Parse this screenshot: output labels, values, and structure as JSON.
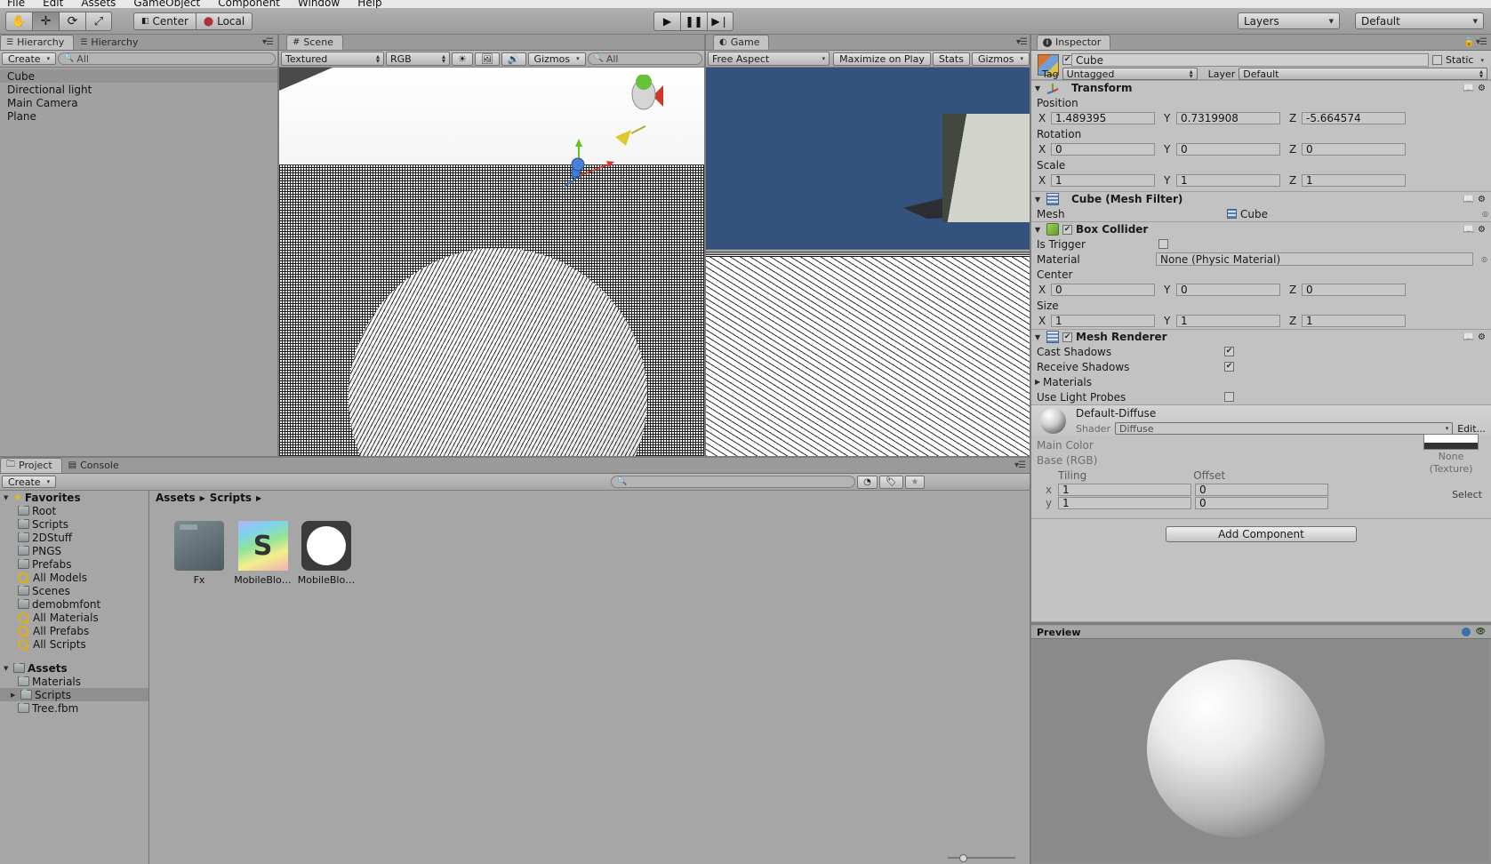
{
  "app": {
    "menu": [
      "File",
      "Edit",
      "Assets",
      "GameObject",
      "Component",
      "Window",
      "Help"
    ]
  },
  "toolbar": {
    "tools": [
      {
        "name": "hand-tool",
        "glyph": "✋",
        "active": false
      },
      {
        "name": "move-tool",
        "glyph": "✛",
        "active": true
      },
      {
        "name": "rotate-tool",
        "glyph": "⟳",
        "active": false
      },
      {
        "name": "scale-tool",
        "glyph": "⤢",
        "active": false
      }
    ],
    "pivot_label": "Center",
    "space_label": "Local",
    "play_label": "▶",
    "pause_label": "❚❚",
    "step_label": "▶❘",
    "layers_label": "Layers",
    "layout_label": "Default"
  },
  "hierarchy": {
    "tab_label": "Hierarchy",
    "tab_label_2": "Hierarchy",
    "create_label": "Create",
    "search_placeholder": "All",
    "items": [
      {
        "label": "Cube",
        "selected": true
      },
      {
        "label": "Directional light",
        "selected": false
      },
      {
        "label": "Main Camera",
        "selected": false
      },
      {
        "label": "Plane",
        "selected": false
      }
    ]
  },
  "scene": {
    "tab_label": "Scene",
    "draw_mode": "Textured",
    "render_mode": "RGB",
    "gizmos_label": "Gizmos",
    "search_placeholder": "All",
    "lighting_icon": "sun-icon",
    "fx_icon": "image-icon",
    "audio_icon": "speaker-icon"
  },
  "game": {
    "tab_label": "Game",
    "aspect_label": "Free Aspect",
    "maximize_label": "Maximize on Play",
    "stats_label": "Stats",
    "gizmos_label": "Gizmos"
  },
  "inspector": {
    "tab_label": "Inspector",
    "object_name": "Cube",
    "object_enabled": true,
    "static_label": "Static",
    "tag_label": "Tag",
    "tag_value": "Untagged",
    "layer_label": "Layer",
    "layer_value": "Default",
    "transform": {
      "title": "Transform",
      "position_label": "Position",
      "position": {
        "x": "1.489395",
        "y": "0.7319908",
        "z": "-5.664574"
      },
      "rotation_label": "Rotation",
      "rotation": {
        "x": "0",
        "y": "0",
        "z": "0"
      },
      "scale_label": "Scale",
      "scale": {
        "x": "1",
        "y": "1",
        "z": "1"
      }
    },
    "mesh_filter": {
      "title": "Cube (Mesh Filter)",
      "mesh_label": "Mesh",
      "mesh_value": "Cube"
    },
    "box_collider": {
      "title": "Box Collider",
      "enabled": true,
      "is_trigger_label": "Is Trigger",
      "is_trigger": false,
      "material_label": "Material",
      "material_value": "None (Physic Material)",
      "center_label": "Center",
      "center": {
        "x": "0",
        "y": "0",
        "z": "0"
      },
      "size_label": "Size",
      "size": {
        "x": "1",
        "y": "1",
        "z": "1"
      }
    },
    "mesh_renderer": {
      "title": "Mesh Renderer",
      "enabled": true,
      "cast_shadows_label": "Cast Shadows",
      "cast_shadows": true,
      "receive_shadows_label": "Receive Shadows",
      "receive_shadows": true,
      "materials_label": "Materials",
      "use_light_probes_label": "Use Light Probes",
      "use_light_probes": false
    },
    "material": {
      "name": "Default-Diffuse",
      "shader_label": "Shader",
      "shader_value": "Diffuse",
      "main_color_label": "Main Color",
      "base_rgb_label": "Base (RGB)",
      "tiling_label": "Tiling",
      "offset_label": "Offset",
      "x_label": "x",
      "y_label": "y",
      "tiling": {
        "x": "1",
        "y": "1"
      },
      "offset": {
        "x": "0",
        "y": "0"
      },
      "texture_none_label": "None",
      "texture_type_label": "(Texture)",
      "select_label": "Select"
    },
    "add_component_label": "Add Component"
  },
  "preview": {
    "title": "Preview"
  },
  "project": {
    "tab_label": "Project",
    "console_tab_label": "Console",
    "create_label": "Create",
    "search_placeholder": "",
    "breadcrumb": [
      "Assets",
      "Scripts"
    ],
    "favorites": {
      "label": "Favorites",
      "items": [
        {
          "label": "Root",
          "icon": "folder-favorite-icon"
        },
        {
          "label": "Scripts",
          "icon": "folder-favorite-icon"
        },
        {
          "label": "2DStuff",
          "icon": "folder-favorite-icon"
        },
        {
          "label": "PNGS",
          "icon": "folder-favorite-icon"
        },
        {
          "label": "Prefabs",
          "icon": "folder-favorite-icon"
        },
        {
          "label": "All Models",
          "icon": "search-saved-icon"
        },
        {
          "label": "Scenes",
          "icon": "folder-favorite-icon"
        },
        {
          "label": "demobmfont",
          "icon": "folder-favorite-icon"
        },
        {
          "label": "All Materials",
          "icon": "search-saved-icon"
        },
        {
          "label": "All Prefabs",
          "icon": "search-saved-icon"
        },
        {
          "label": "All Scripts",
          "icon": "search-saved-icon"
        }
      ]
    },
    "assets": {
      "label": "Assets",
      "items": [
        {
          "label": "Materials",
          "selected": false,
          "expandable": false
        },
        {
          "label": "Scripts",
          "selected": true,
          "expandable": true
        },
        {
          "label": "Tree.fbm",
          "selected": false,
          "expandable": false
        }
      ]
    },
    "grid": [
      {
        "label": "Fx",
        "type": "folder"
      },
      {
        "label": "MobileBlo…",
        "type": "shader"
      },
      {
        "label": "MobileBlo…",
        "type": "material"
      }
    ]
  }
}
